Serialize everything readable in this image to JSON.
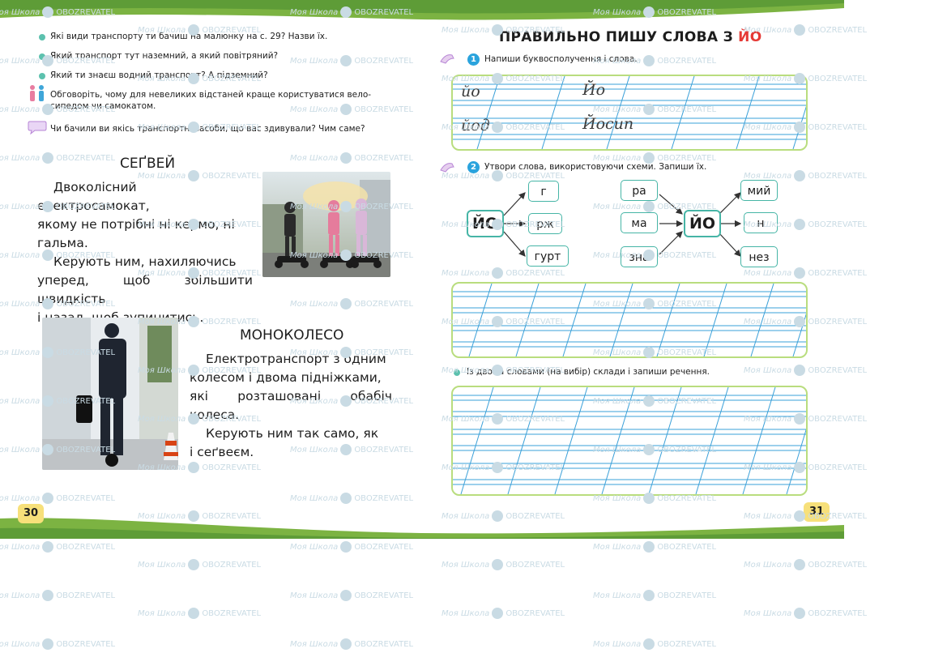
{
  "watermark": {
    "brand": "Моя Школа",
    "site": "OBOZREVATEL"
  },
  "left_page": {
    "questions": [
      "Які види транспорту ти бачиш на малюнку на с. 29? Назви їх.",
      "Який транспорт тут наземний, а який повітряний?",
      "Який ти знаєш водний транспорт? А підземний?",
      "Обговоріть, чому для невеликих відстаней краще користуватися вело-",
      "сипедом чи самокатом.",
      "Чи бачили ви якісь транспортні засоби, що вас здивували? Чим саме?"
    ],
    "segway": {
      "title": "СЕҐВЕЙ",
      "lines": [
        "Двоколісний електросамокат,",
        "якому не потрібні ні кермо, ні",
        "гальма.",
        "Керують ним, нахиляючись",
        "уперед, щоб збільшити швидкість",
        "і назад, щоб зупинитись."
      ]
    },
    "monowheel": {
      "title": "МОНОКОЛЕСО",
      "lines": [
        "Електротранспорт з одним",
        "колесом і двома підніжками,",
        "які розташовані обабіч колеса.",
        "Керують ним так само, як",
        "і сеґвеєм."
      ]
    },
    "page_number": "30"
  },
  "right_page": {
    "title_prefix": "ПРАВИЛЬНО ПИШУ СЛОВА З ",
    "title_highlight": "ЙО",
    "task1": {
      "number": "1",
      "instruction": "Напиши буквосполучення і слова."
    },
    "handwriting": {
      "row1": [
        "йо",
        "Йо"
      ],
      "row2": [
        "йод",
        "Йосип"
      ]
    },
    "task2": {
      "number": "2",
      "instruction": "Утвори слова, використовуючи схеми. Запиши їх.",
      "left_center": "ЙО",
      "left_endings": [
        "г",
        "рж",
        "гурт"
      ],
      "right_center": "ЙО",
      "right_prefixes": [
        "ра",
        "ма",
        "зна"
      ],
      "right_endings": [
        "мий",
        "н",
        "нез"
      ]
    },
    "task3": {
      "instruction": "Із двома словами (на вибір) склади і запиши речення."
    },
    "page_number": "31"
  },
  "colors": {
    "accent_green": "#6aa84f",
    "teal": "#46b5a6",
    "red": "#e53935",
    "panel_border": "#b9dd7e",
    "line_blue": "#3aa0d8"
  }
}
